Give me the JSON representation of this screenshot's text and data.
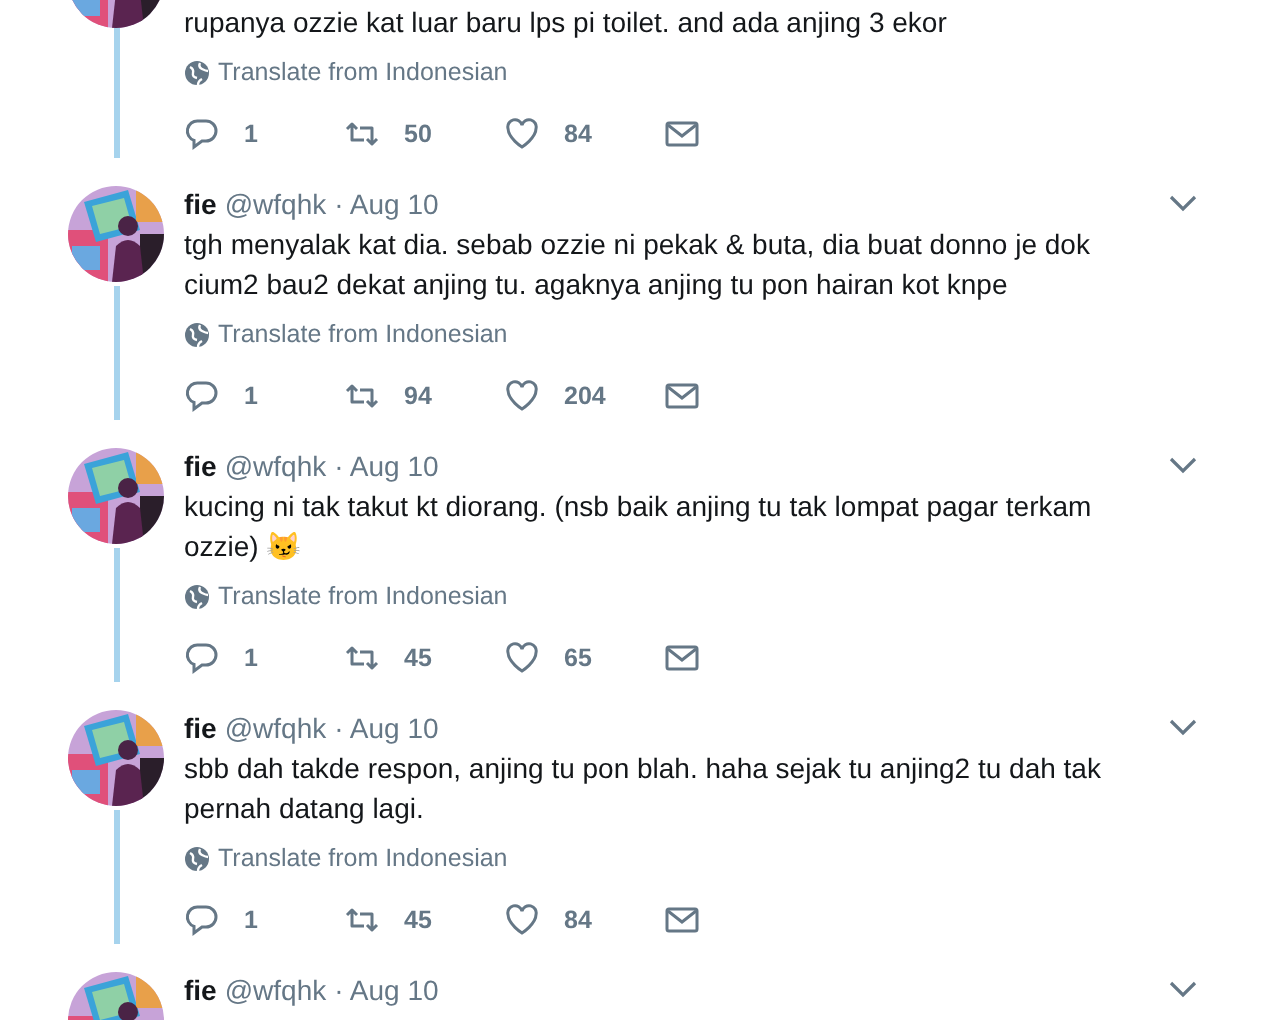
{
  "tweets": [
    {
      "kind": "partial",
      "text": "rupanya ozzie kat luar baru lps pi toilet. and ada anjing 3 ekor",
      "translate": "Translate from Indonesian",
      "replies": "1",
      "retweets": "50",
      "likes": "84",
      "thread_continues": true
    },
    {
      "kind": "full",
      "name": "fie",
      "handle": "@wfqhk",
      "date": "· Aug 10",
      "text": "tgh menyalak kat dia. sebab ozzie ni pekak & buta, dia buat donno je dok cium2 bau2 dekat anjing tu. agaknya anjing tu pon hairan kot knpe",
      "translate": "Translate from Indonesian",
      "replies": "1",
      "retweets": "94",
      "likes": "204",
      "thread_continues": true
    },
    {
      "kind": "full",
      "name": "fie",
      "handle": "@wfqhk",
      "date": "· Aug 10",
      "text": "kucing ni tak takut kt diorang. (nsb baik anjing tu tak lompat pagar terkam ozzie) 😼",
      "translate": "Translate from Indonesian",
      "replies": "1",
      "retweets": "45",
      "likes": "65",
      "thread_continues": true
    },
    {
      "kind": "full",
      "name": "fie",
      "handle": "@wfqhk",
      "date": "· Aug 10",
      "text": "sbb dah takde respon, anjing tu pon blah. haha sejak tu anjing2 tu dah tak pernah datang lagi.",
      "translate": "Translate from Indonesian",
      "replies": "1",
      "retweets": "45",
      "likes": "84",
      "thread_continues": true
    },
    {
      "kind": "header_only",
      "name": "fie",
      "handle": "@wfqhk",
      "date": "· Aug 10"
    }
  ]
}
